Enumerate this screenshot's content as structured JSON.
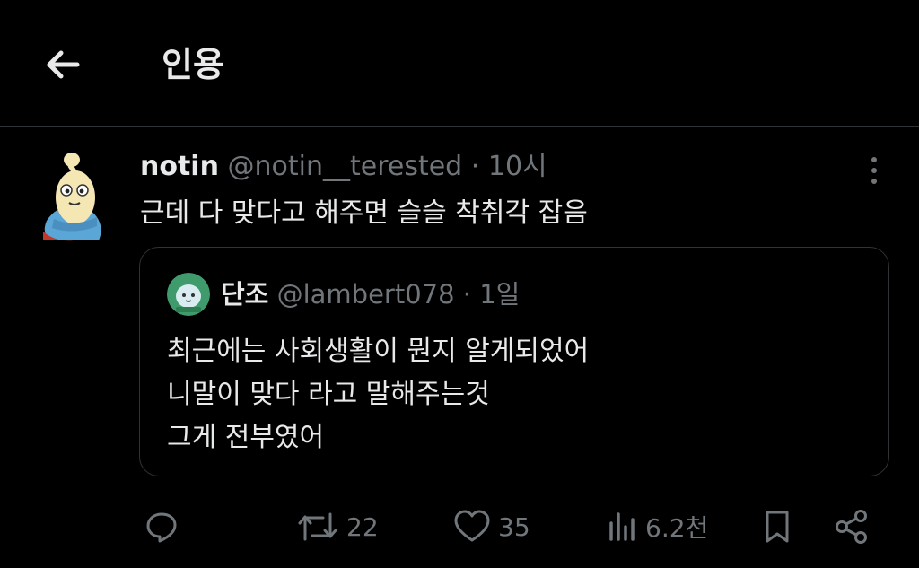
{
  "header": {
    "title": "인용"
  },
  "post": {
    "display_name": "notin",
    "handle": "@notin__terested",
    "separator": "·",
    "time": "10시",
    "text": "근데 다 맞다고 해주면 슬슬 착취각 잡음"
  },
  "quote": {
    "display_name": "단조",
    "handle": "@lambert078",
    "separator": "·",
    "time": "1일",
    "lines": [
      "최근에는 사회생활이 뭔지 알게되었어",
      "니말이 맞다 라고 말해주는것",
      "그게 전부였어"
    ]
  },
  "actions": {
    "replies": "",
    "reposts": "22",
    "likes": "35",
    "views": "6.2천"
  },
  "icons": [
    "back-arrow-icon",
    "more-icon",
    "reply-icon",
    "repost-icon",
    "like-icon",
    "views-icon",
    "bookmark-icon",
    "share-icon"
  ]
}
